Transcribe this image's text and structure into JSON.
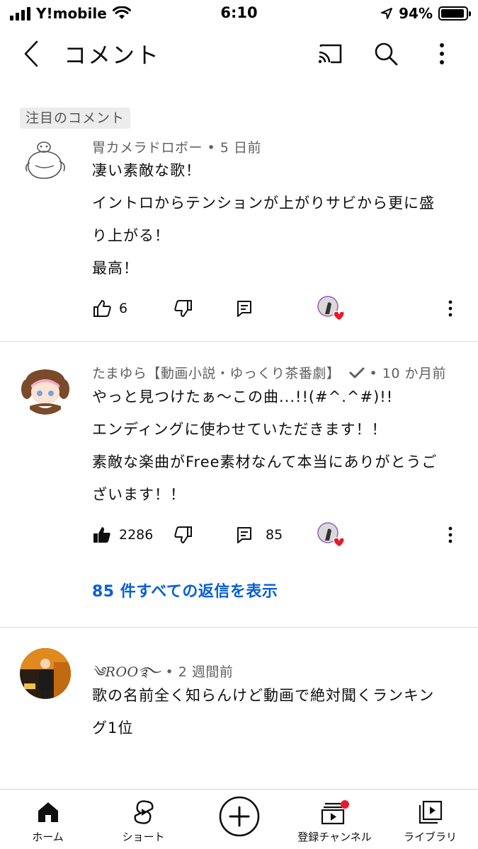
{
  "status_bar": {
    "carrier": "Y!mobile",
    "time": "6:10",
    "battery_percent": "94%",
    "battery_level": 0.94
  },
  "header": {
    "title": "コメント",
    "icons": [
      "back-icon",
      "cast-icon",
      "search-icon",
      "more-vert-icon"
    ]
  },
  "pinned_label": "注目のコメント",
  "comments": [
    {
      "author": "胃カメラドロボー",
      "time": "5 日前",
      "lines": [
        "凄い素敵な歌！",
        "イントロからテンションが上がりサビから更に盛",
        "り上がる！",
        "最高！"
      ],
      "likes": "6",
      "replies": "",
      "liked": false
    },
    {
      "author": "たまゆら【動画小説・ゆっくり茶番劇】",
      "time": "10 か月前",
      "verified": true,
      "lines": [
        "やっと見つけたぁ〜この曲...!!(#^.^#)!!",
        "エンディングに使わせていただきます！！",
        "素敵な楽曲がFree素材なんて本当にありがとうご",
        "ざいます！！"
      ],
      "likes": "2286",
      "replies": "85",
      "liked": true,
      "view_replies": "85 件すべての返信を表示"
    },
    {
      "author": "ROO",
      "time": "2 週間前",
      "lines": [
        "歌の名前全く知らんけど動画で絶対聞くランキン",
        "グ1位"
      ]
    }
  ],
  "bottom_nav": [
    {
      "label": "ホーム",
      "icon": "home-icon"
    },
    {
      "label": "ショート",
      "icon": "shorts-icon"
    },
    {
      "label": "",
      "icon": "create-icon"
    },
    {
      "label": "登録チャンネル",
      "icon": "subscriptions-icon"
    },
    {
      "label": "ライブラリ",
      "icon": "library-icon"
    }
  ],
  "colors": {
    "link": "#065fd4",
    "heart": "#e8192c",
    "notification_dot": "#e8192c"
  }
}
